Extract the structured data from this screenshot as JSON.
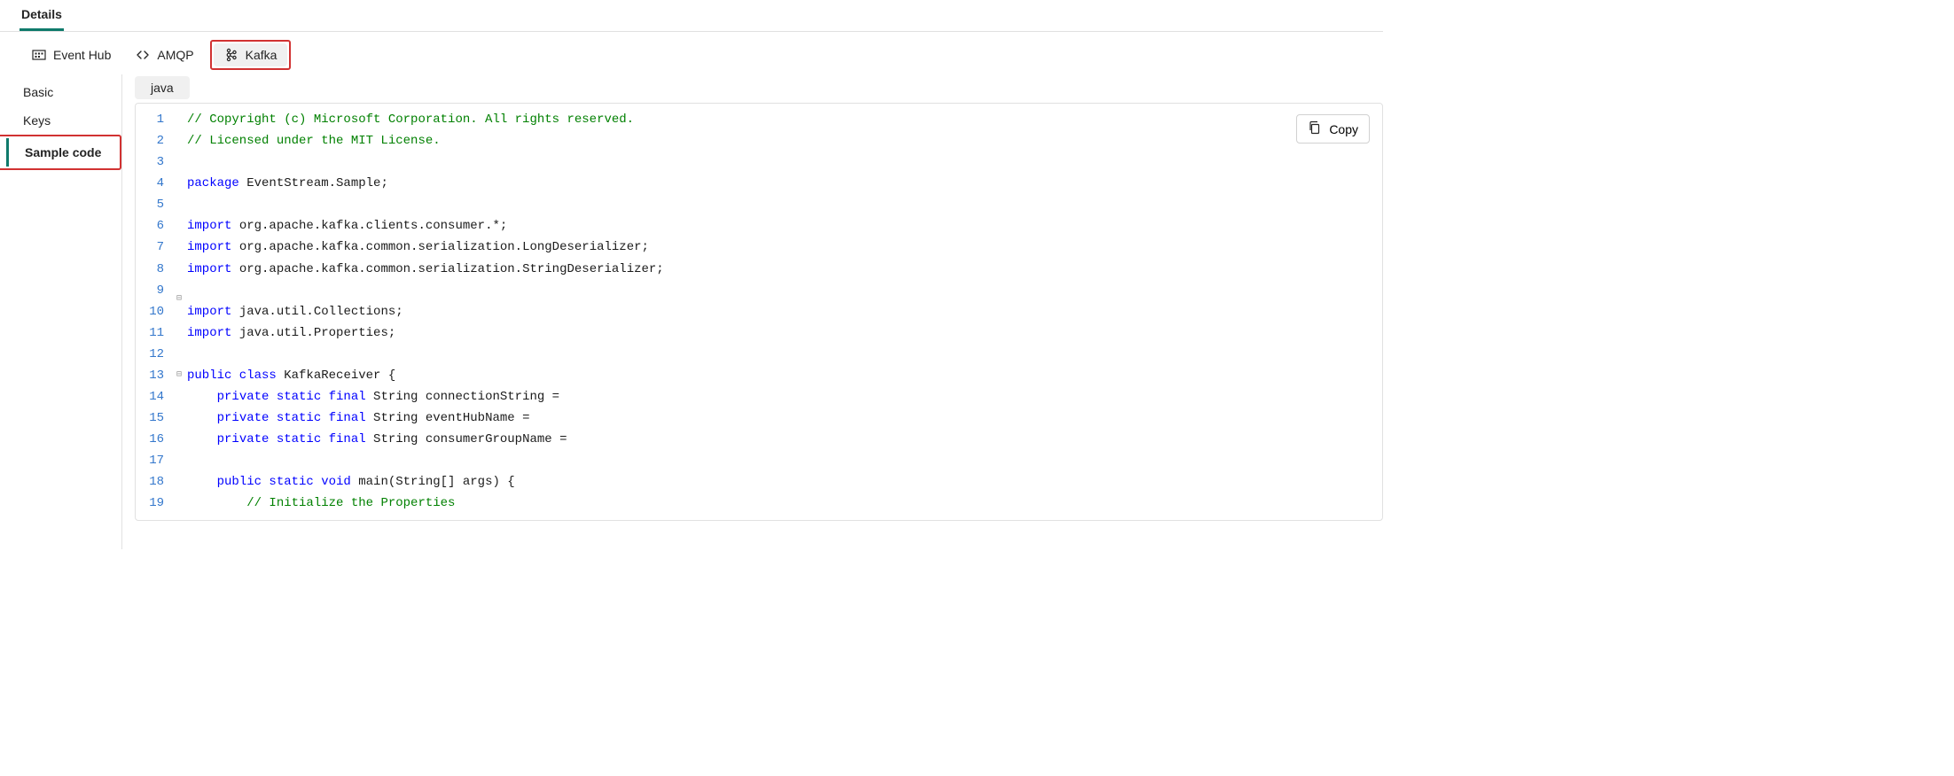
{
  "header": {
    "active_tab": "Details"
  },
  "conn_tabs": {
    "event_hub": "Event Hub",
    "amqp": "AMQP",
    "kafka": "Kafka"
  },
  "sidebar": {
    "items": [
      "Basic",
      "Keys",
      "Sample code"
    ],
    "active_index": 2
  },
  "lang_tabs": {
    "active": "java"
  },
  "copy_label": "Copy",
  "code": {
    "line_count": 19,
    "fold_markers": {
      "13": "⊟",
      "18": "⊟"
    },
    "lines": [
      [
        {
          "t": "comment",
          "s": "// Copyright (c) Microsoft Corporation. All rights reserved."
        }
      ],
      [
        {
          "t": "comment",
          "s": "// Licensed under the MIT License."
        }
      ],
      [],
      [
        {
          "t": "kw",
          "s": "package"
        },
        {
          "t": "plain",
          "s": " EventStream.Sample;"
        }
      ],
      [],
      [
        {
          "t": "kw",
          "s": "import"
        },
        {
          "t": "plain",
          "s": " org.apache.kafka.clients.consumer.*;"
        }
      ],
      [
        {
          "t": "kw",
          "s": "import"
        },
        {
          "t": "plain",
          "s": " org.apache.kafka.common.serialization.LongDeserializer;"
        }
      ],
      [
        {
          "t": "kw",
          "s": "import"
        },
        {
          "t": "plain",
          "s": " org.apache.kafka.common.serialization.StringDeserializer;"
        }
      ],
      [],
      [
        {
          "t": "kw",
          "s": "import"
        },
        {
          "t": "plain",
          "s": " java.util.Collections;"
        }
      ],
      [
        {
          "t": "kw",
          "s": "import"
        },
        {
          "t": "plain",
          "s": " java.util.Properties;"
        }
      ],
      [],
      [
        {
          "t": "kw",
          "s": "public class"
        },
        {
          "t": "plain",
          "s": " KafkaReceiver {"
        }
      ],
      [
        {
          "t": "plain",
          "s": "    "
        },
        {
          "t": "kw",
          "s": "private static final"
        },
        {
          "t": "plain",
          "s": " String connectionString ="
        }
      ],
      [
        {
          "t": "plain",
          "s": "    "
        },
        {
          "t": "kw",
          "s": "private static final"
        },
        {
          "t": "plain",
          "s": " String eventHubName ="
        }
      ],
      [
        {
          "t": "plain",
          "s": "    "
        },
        {
          "t": "kw",
          "s": "private static final"
        },
        {
          "t": "plain",
          "s": " String consumerGroupName ="
        }
      ],
      [],
      [
        {
          "t": "plain",
          "s": "    "
        },
        {
          "t": "kw",
          "s": "public static void"
        },
        {
          "t": "plain",
          "s": " main(String[] args) {"
        }
      ],
      [
        {
          "t": "plain",
          "s": "        "
        },
        {
          "t": "comment",
          "s": "// Initialize the Properties"
        }
      ]
    ]
  }
}
